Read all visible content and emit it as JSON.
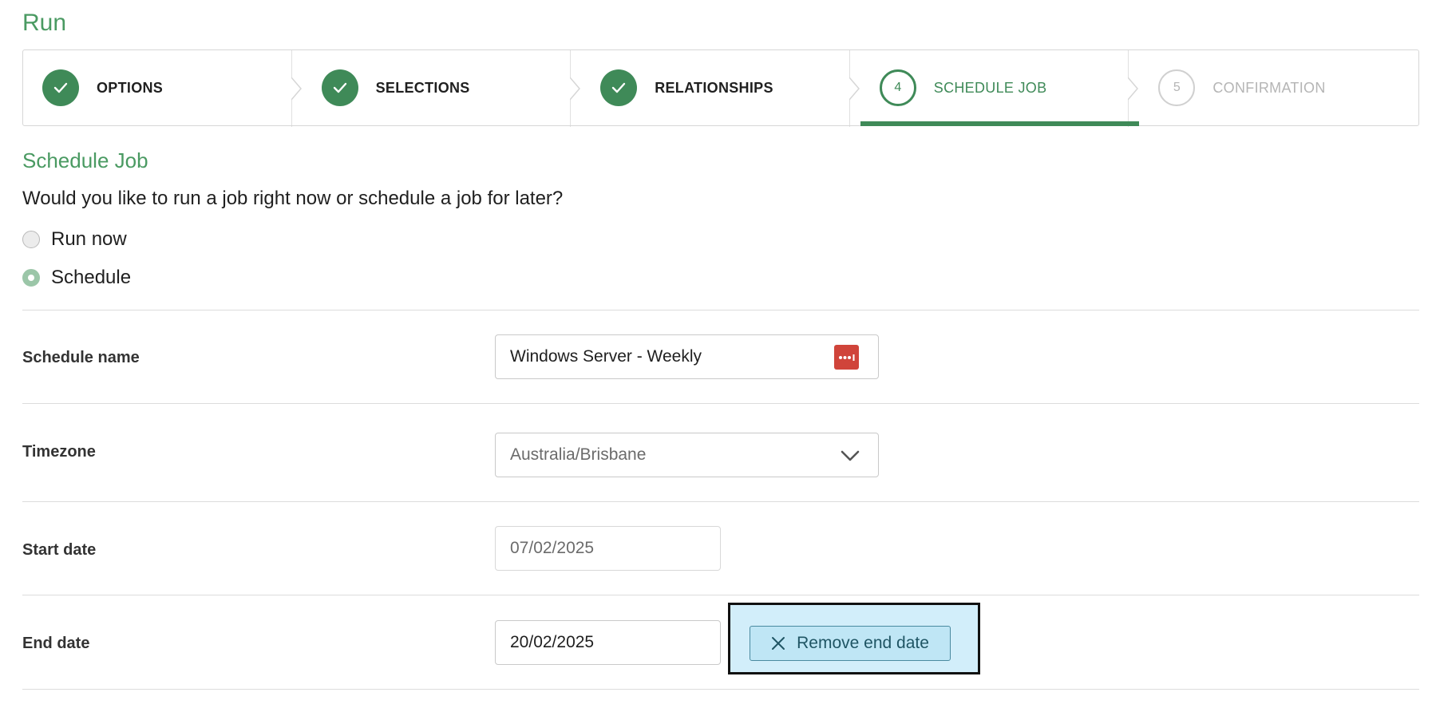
{
  "page": {
    "title": "Run"
  },
  "stepper": {
    "steps": [
      {
        "number": "",
        "label": "OPTIONS",
        "state": "done"
      },
      {
        "number": "",
        "label": "SELECTIONS",
        "state": "done"
      },
      {
        "number": "",
        "label": "RELATIONSHIPS",
        "state": "done"
      },
      {
        "number": "4",
        "label": "SCHEDULE JOB",
        "state": "active"
      },
      {
        "number": "5",
        "label": "CONFIRMATION",
        "state": "pending"
      }
    ]
  },
  "schedule": {
    "title": "Schedule Job",
    "question": "Would you like to run a job right now or schedule a job for later?",
    "options": [
      {
        "label": "Run now",
        "checked": false
      },
      {
        "label": "Schedule",
        "checked": true
      }
    ]
  },
  "form": {
    "schedule_name": {
      "label": "Schedule name",
      "value": "Windows Server - Weekly",
      "icon": "password-manager-icon"
    },
    "timezone": {
      "label": "Timezone",
      "value": "Australia/Brisbane",
      "icon": "chevron-down-icon"
    },
    "start_date": {
      "label": "Start date",
      "value": "07/02/2025"
    },
    "end_date": {
      "label": "End date",
      "value": "20/02/2025"
    },
    "remove_end_date": {
      "label": "Remove end date",
      "icon": "close-icon"
    }
  },
  "colors": {
    "accent": "#3f8a58",
    "title_green": "#4a9a62",
    "highlight_bg": "#d2eefa",
    "danger_icon": "#d0443a"
  }
}
